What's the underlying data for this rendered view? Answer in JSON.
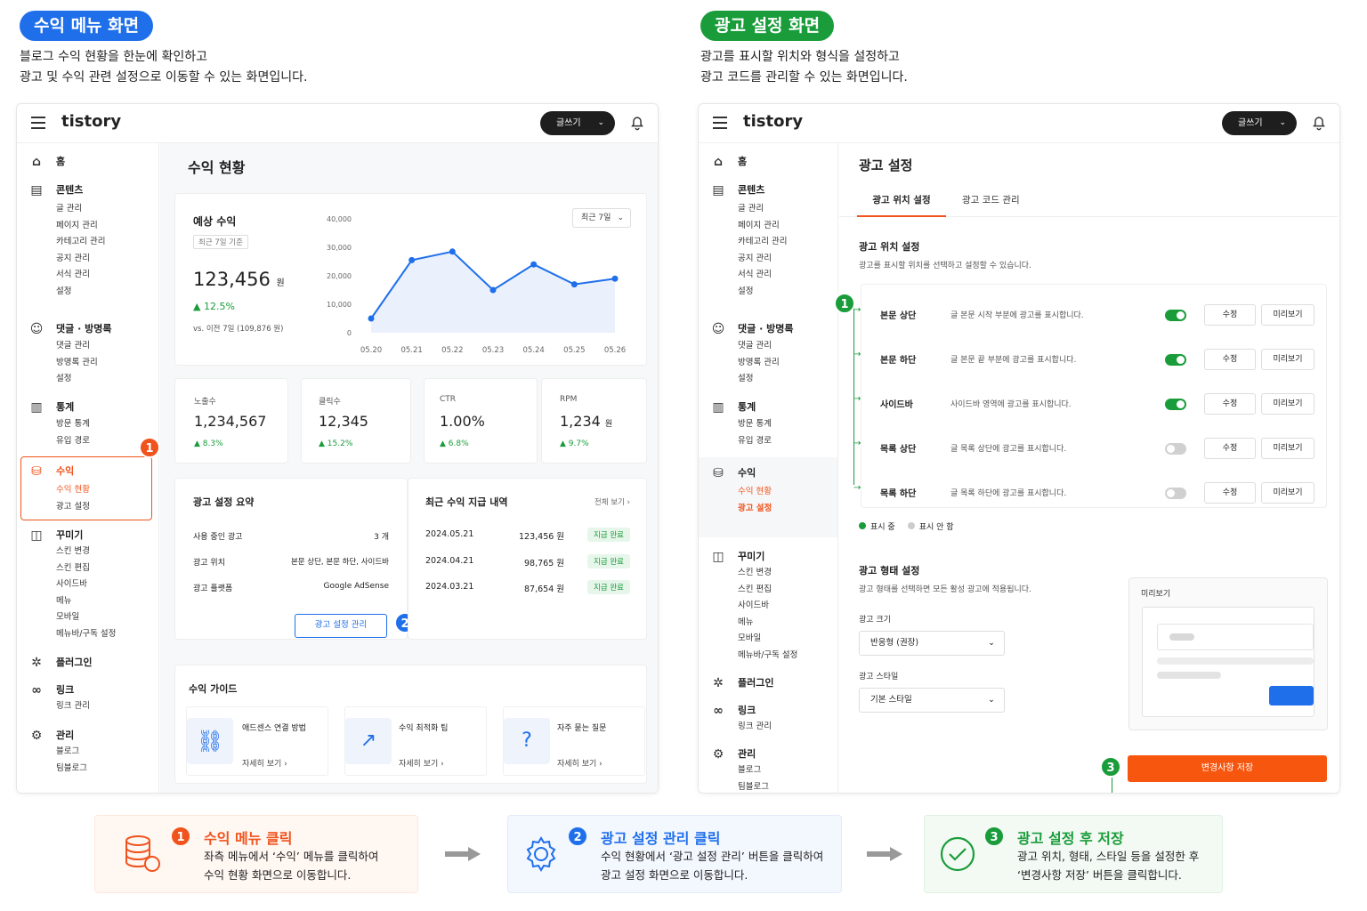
{
  "left_section": {
    "pill": "수익 메뉴 화면",
    "desc1": "블로그 수익 현황을 한눈에 확인하고",
    "desc2": "광고 및 수익 관련 설정으로 이동할 수 있는 화면입니다."
  },
  "right_section": {
    "pill": "광고 설정 화면",
    "desc1": "광고를 표시할 위치와 형식을 설정하고",
    "desc2": "광고 코드를 관리할 수 있는 화면입니다."
  },
  "header": {
    "logo": "tistory",
    "write_label": "글쓰기"
  },
  "sidebar": {
    "home": "홈",
    "content": {
      "label": "콘텐츠",
      "items": [
        "글 관리",
        "페이지 관리",
        "카테고리 관리",
        "공지 관리",
        "서식 관리",
        "설정"
      ]
    },
    "comments": {
      "label": "댓글 · 방명록",
      "items": [
        "댓글 관리",
        "방명록 관리",
        "설정"
      ]
    },
    "stats": {
      "label": "통계",
      "items": [
        "방문 통계",
        "유입 경로"
      ]
    },
    "revenue": {
      "label": "수익",
      "items": [
        "수익 현황",
        "광고 설정"
      ]
    },
    "design": {
      "label": "꾸미기",
      "items": [
        "스킨 변경",
        "스킨 편집",
        "사이드바",
        "메뉴",
        "모바일",
        "메뉴바/구독 설정"
      ]
    },
    "plugin": {
      "label": "플러그인"
    },
    "link": {
      "label": "링크",
      "items": [
        "링크 관리"
      ]
    },
    "manage": {
      "label": "관리",
      "items": [
        "블로그",
        "팀블로그"
      ]
    }
  },
  "revenue_page": {
    "title": "수익 현황",
    "estimated": {
      "label": "예상 수익",
      "basis": "최근 7일 기준",
      "value": "123,456",
      "unit": "원",
      "change": "▲ 12.5%",
      "compare": "vs. 이전 7일 (109,876 원)",
      "range_select": "최근 7일"
    },
    "metrics": [
      {
        "label": "노출수",
        "value": "1,234,567",
        "unit": "",
        "change": "▲ 8.3%"
      },
      {
        "label": "클릭수",
        "value": "12,345",
        "unit": "",
        "change": "▲ 15.2%"
      },
      {
        "label": "CTR",
        "value": "1.00%",
        "unit": "",
        "change": "▲ 6.8%"
      },
      {
        "label": "RPM",
        "value": "1,234",
        "unit": "원",
        "change": "▲ 9.7%"
      }
    ],
    "ad_summary": {
      "title": "광고 설정 요약",
      "rows": [
        {
          "k": "사용 중인 광고",
          "v": "3 개"
        },
        {
          "k": "광고 위치",
          "v": "본문 상단, 본문 하단, 사이드바"
        },
        {
          "k": "광고 플랫폼",
          "v": "Google AdSense"
        }
      ],
      "manage_button": "광고 설정 관리"
    },
    "payouts": {
      "title": "최근 수익 지급 내역",
      "view_all": "전체 보기 ›",
      "rows": [
        {
          "date": "2024.05.21",
          "amount": "123,456 원",
          "status": "지급 완료"
        },
        {
          "date": "2024.04.21",
          "amount": "98,765 원",
          "status": "지급 완료"
        },
        {
          "date": "2024.03.21",
          "amount": "87,654 원",
          "status": "지급 완료"
        }
      ]
    },
    "guide": {
      "title": "수익 가이드",
      "items": [
        {
          "title": "애드센스 연결 방법",
          "more": "자세히 보기 ›"
        },
        {
          "title": "수익 최적화 팁",
          "more": "자세히 보기 ›"
        },
        {
          "title": "자주 묻는 질문",
          "more": "자세히 보기 ›"
        }
      ]
    }
  },
  "chart_data": {
    "type": "line",
    "categories": [
      "05.20",
      "05.21",
      "05.22",
      "05.23",
      "05.24",
      "05.25",
      "05.26"
    ],
    "values": [
      5000,
      25500,
      28500,
      15000,
      24000,
      17000,
      19000
    ],
    "yticks": [
      "40,000",
      "30,000",
      "20,000",
      "10,000",
      "0"
    ],
    "ylim": [
      0,
      40000
    ],
    "color": "#1f6feb"
  },
  "ad_page": {
    "title": "광고 설정",
    "tabs": [
      {
        "label": "광고 위치 설정"
      },
      {
        "label": "광고 코드 관리"
      }
    ],
    "position": {
      "title": "광고 위치 설정",
      "desc": "광고를 표시할 위치를 선택하고 설정할 수 있습니다.",
      "rows": [
        {
          "name": "본문 상단",
          "desc": "글 본문 시작 부분에 광고를 표시합니다.",
          "on": true
        },
        {
          "name": "본문 하단",
          "desc": "글 본문 끝 부분에 광고를 표시합니다.",
          "on": true
        },
        {
          "name": "사이드바",
          "desc": "사이드바 영역에 광고를 표시합니다.",
          "on": true
        },
        {
          "name": "목록 상단",
          "desc": "글 목록 상단에 광고를 표시합니다.",
          "on": false
        },
        {
          "name": "목록 하단",
          "desc": "글 목록 하단에 광고를 표시합니다.",
          "on": false
        }
      ],
      "edit_label": "수정",
      "preview_label": "미리보기",
      "legend_on": "표시 중",
      "legend_off": "표시 안 함"
    },
    "format": {
      "title": "광고 형태 설정",
      "desc": "광고 형태를 선택하면 모든 활성 광고에 적용됩니다.",
      "size_label": "광고 크기",
      "size_value": "반응형 (권장)",
      "style_label": "광고 스타일",
      "style_value": "기본 스타일",
      "preview_title": "미리보기"
    },
    "save_button": "변경사항 저장"
  },
  "steps": [
    {
      "num": "1",
      "title": "수익 메뉴 클릭",
      "line1": "좌측 메뉴에서 ‘수익’ 메뉴를 클릭하여",
      "line2": "수익 현황 화면으로 이동합니다."
    },
    {
      "num": "2",
      "title": "광고 설정 관리 클릭",
      "line1": "수익 현황에서 ‘광고 설정 관리’ 버튼을 클릭하여",
      "line2": "광고 설정 화면으로 이동합니다."
    },
    {
      "num": "3",
      "title": "광고 설정 후 저장",
      "line1": "광고 위치, 형태, 스타일 등을 설정한 후",
      "line2": "‘변경사항 저장’ 버튼을 클릭합니다."
    }
  ],
  "colors": {
    "orange": "#f0531c",
    "blue": "#1f6feb",
    "green": "#1a9c3b"
  }
}
